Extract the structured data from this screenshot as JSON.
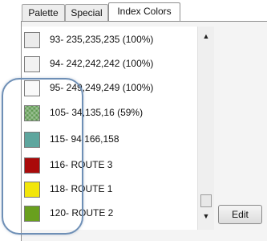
{
  "tabs": [
    {
      "label": "Palette"
    },
    {
      "label": "Special"
    },
    {
      "label": "Index Colors"
    }
  ],
  "colors": {
    "c93": "#ebebeb",
    "c94": "#f2f2f2",
    "c95": "#f9f9f9",
    "c105": "#5f9a52",
    "c115": "#5ea69e",
    "c116": "#aa0a0a",
    "c118": "#f2e60a",
    "c120": "#69a01e"
  },
  "items": [
    {
      "label": "93- 235,235,235 (100%)",
      "color": "#ebebeb",
      "icon": "color-swatch"
    },
    {
      "label": "94- 242,242,242 (100%)",
      "color": "#f2f2f2",
      "icon": "color-swatch"
    },
    {
      "label": "95- 249,249,249 (100%)",
      "color": "#f9f9f9",
      "icon": "color-swatch"
    },
    {
      "label": "105- 34,135,16 (59%)",
      "color": "#5f9a52",
      "icon": "color-swatch"
    },
    {
      "label": "115- 94,166,158",
      "color": "#5ea69e",
      "icon": "color-swatch"
    },
    {
      "label": "116- ROUTE 3",
      "color": "#aa0a0a",
      "icon": "color-swatch"
    },
    {
      "label": "118- ROUTE 1",
      "color": "#f2e60a",
      "icon": "color-swatch"
    },
    {
      "label": "120- ROUTE 2",
      "color": "#69a01e",
      "icon": "color-swatch"
    }
  ],
  "scroll": {
    "up_glyph": "▲",
    "down_glyph": "▼"
  },
  "edit_label": "Edit"
}
